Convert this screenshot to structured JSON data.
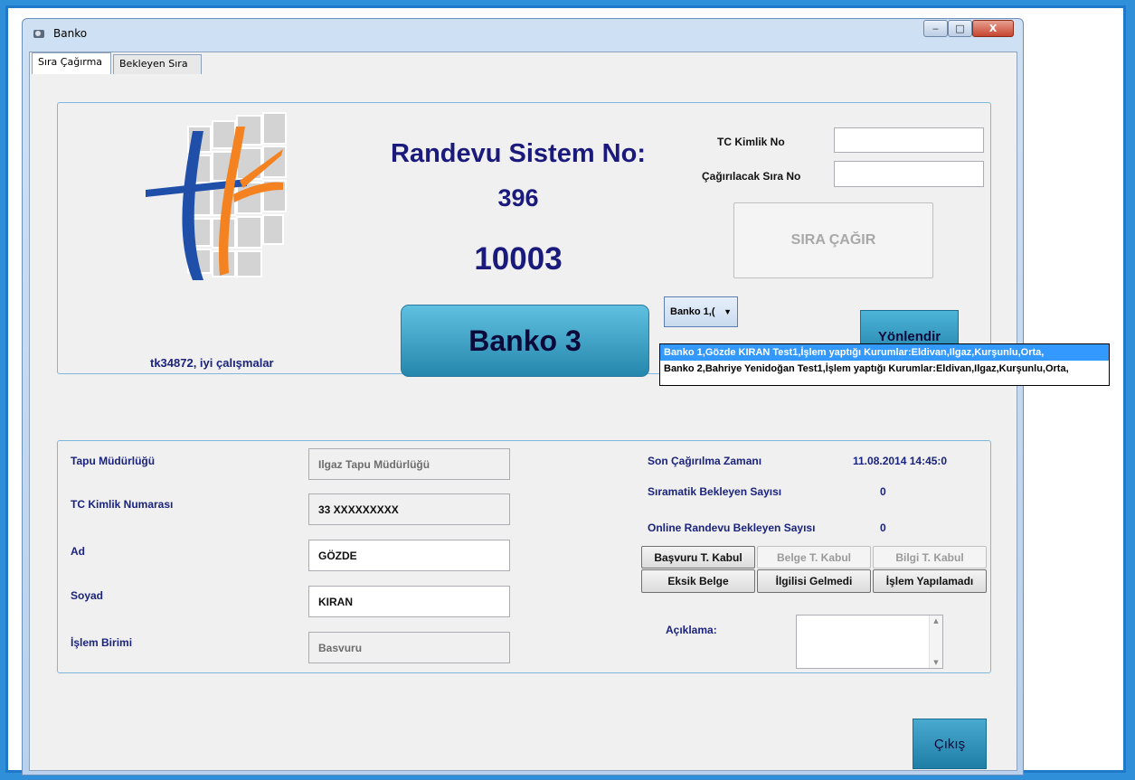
{
  "window": {
    "title": "Banko",
    "min": "‒",
    "max": "□",
    "close": "X"
  },
  "tabs": [
    {
      "label": "Sıra Çağırma"
    },
    {
      "label": "Bekleyen Sıra"
    }
  ],
  "top": {
    "heading": "Randevu Sistem No:",
    "sistem_no": "396",
    "sira_no": "10003",
    "banko": "Banko 3",
    "user_msg": "tk34872, iyi çalışmalar",
    "tc_label": "TC Kimlik No",
    "cagirilacak_label": "Çağırılacak Sıra No",
    "tc_value": "",
    "cagirilacak_value": "",
    "sira_cagir": "SIRA ÇAĞIR",
    "dropdown_value": "Banko 1,(",
    "yonlendir": "Yönlendir",
    "dropdown_options": [
      "Banko 1,Gözde KIRAN Test1,İşlem yaptığı Kurumlar:Eldivan,Ilgaz,Kurşunlu,Orta,",
      "Banko 2,Bahriye Yenidoğan Test1,İşlem yaptığı Kurumlar:Eldivan,Ilgaz,Kurşunlu,Orta,"
    ]
  },
  "form": {
    "tapu_label": "Tapu Müdürlüğü",
    "tapu_value": "Ilgaz Tapu Müdürlüğü",
    "tc_label": "TC Kimlik Numarası",
    "tc_value": "33 XXXXXXXXX",
    "ad_label": "Ad",
    "ad_value": "GÖZDE",
    "soyad_label": "Soyad",
    "soyad_value": "KIRAN",
    "birim_label": "İşlem Birimi",
    "birim_value": "Basvuru"
  },
  "status": {
    "son_label": "Son Çağırılma Zamanı",
    "son_value": "11.08.2014 14:45:0",
    "siramatik_label": "Sıramatik Bekleyen Sayısı",
    "siramatik_value": "0",
    "online_label": "Online Randevu Bekleyen Sayısı",
    "online_value": "0",
    "aciklama_label": "Açıklama:",
    "buttons_row1": [
      "Başvuru T. Kabul",
      "Belge T. Kabul",
      "Bilgi T. Kabul"
    ],
    "buttons_row2": [
      "Eksik Belge",
      "İlgilisi Gelmedi",
      "İşlem Yapılamadı"
    ]
  },
  "cikis": "Çıkış",
  "colors": {
    "accent": "#1a1a7c",
    "teal": "#2a8fb3",
    "selection": "#3399ff",
    "logo_blue": "#1f4fa8",
    "logo_orange": "#f58220"
  }
}
